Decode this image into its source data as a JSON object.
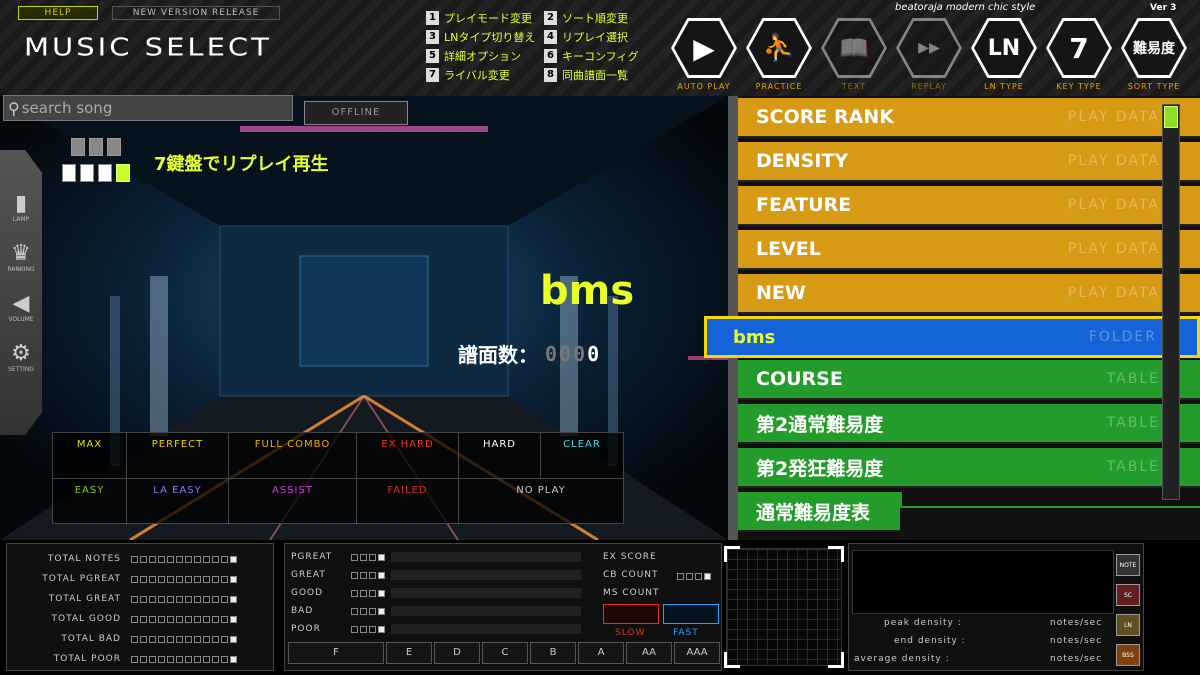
{
  "header": {
    "help_label": "HELP",
    "new_version_label": "NEW VERSION RELEASE",
    "title": "MUSIC SELECT",
    "skin_name": "beatoraja modern chic style",
    "version": "Ver 3"
  },
  "key_menu": [
    {
      "key": "1",
      "label": "プレイモード変更"
    },
    {
      "key": "2",
      "label": "ソート順変更"
    },
    {
      "key": "3",
      "label": "LNタイプ切り替え"
    },
    {
      "key": "4",
      "label": "リプレイ選択"
    },
    {
      "key": "5",
      "label": "詳細オプション"
    },
    {
      "key": "6",
      "label": "キーコンフィグ"
    },
    {
      "key": "7",
      "label": "ライバル変更"
    },
    {
      "key": "8",
      "label": "同曲譜面一覧"
    }
  ],
  "hex_buttons": [
    {
      "icon": "play-icon",
      "glyph": "▶",
      "label": "AUTO PLAY"
    },
    {
      "icon": "practice-icon",
      "glyph": "⛹",
      "label": "PRACTICE"
    },
    {
      "icon": "text-icon",
      "glyph": "📖",
      "label": "TEXT"
    },
    {
      "icon": "replay-icon",
      "glyph": "▶▶",
      "label": "REPLAY"
    },
    {
      "icon": "ln-icon",
      "glyph": "LN",
      "label": "LN TYPE"
    },
    {
      "icon": "key-type-icon",
      "glyph": "7",
      "label": "KEY TYPE"
    },
    {
      "icon": "sort-icon",
      "glyph": "難易度",
      "label": "SORT TYPE"
    }
  ],
  "search": {
    "placeholder": "search song"
  },
  "offline_label": "OFFLINE",
  "sidebar": [
    {
      "icon": "lamp-icon",
      "label": "LAMP"
    },
    {
      "icon": "ranking-icon",
      "label": "RANKING"
    },
    {
      "icon": "volume-icon",
      "label": "VOLUME"
    },
    {
      "icon": "setting-icon",
      "label": "SETTING"
    }
  ],
  "mode_text": "7鍵盤でリプレイ再生",
  "selected_song": "bms",
  "chart_count": {
    "label": "譜面数：",
    "digits": [
      "0",
      "0",
      "0",
      "0"
    ]
  },
  "lamps": {
    "row1": [
      {
        "label": "MAX",
        "color": "#e8e000"
      },
      {
        "label": "PERFECT",
        "color": "#f0d000"
      },
      {
        "label": "FULL COMBO",
        "color": "#f0b000"
      },
      {
        "label": "EX HARD",
        "color": "#ff3030"
      },
      {
        "label": "HARD",
        "color": "#ffffff"
      },
      {
        "label": "CLEAR",
        "color": "#40e0e8"
      }
    ],
    "row2": [
      {
        "label": "EASY",
        "color": "#80d020"
      },
      {
        "label": "LA EASY",
        "color": "#8080ff"
      },
      {
        "label": "ASSIST",
        "color": "#d040e0"
      },
      {
        "label": "FAILED",
        "color": "#e03020"
      },
      {
        "label": "NO PLAY",
        "color": "#cccccc"
      }
    ]
  },
  "list_items": [
    {
      "label": "SCORE RANK",
      "tag": "PLAY DATA",
      "type": "orange"
    },
    {
      "label": "DENSITY",
      "tag": "PLAY DATA",
      "type": "orange"
    },
    {
      "label": "FEATURE",
      "tag": "PLAY DATA",
      "type": "orange"
    },
    {
      "label": "LEVEL",
      "tag": "PLAY DATA",
      "type": "orange"
    },
    {
      "label": "NEW",
      "tag": "PLAY DATA",
      "type": "orange"
    },
    {
      "label": "bms",
      "tag": "FOLDER",
      "type": "sel"
    },
    {
      "label": "COURSE",
      "tag": "TABLE",
      "type": "green"
    },
    {
      "label": "第2通常難易度",
      "tag": "TABLE",
      "type": "green"
    },
    {
      "label": "第2発狂難易度",
      "tag": "TABLE",
      "type": "green"
    },
    {
      "label": "通常難易度表",
      "tag": "",
      "type": "green"
    }
  ],
  "stats": [
    "TOTAL NOTES",
    "TOTAL PGREAT",
    "TOTAL GREAT",
    "TOTAL GOOD",
    "TOTAL BAD",
    "TOTAL POOR"
  ],
  "judges": [
    "PGREAT",
    "GREAT",
    "GOOD",
    "BAD",
    "POOR"
  ],
  "score": {
    "ex_score": "EX SCORE",
    "cb_count": "CB COUNT",
    "ms_count": "MS COUNT",
    "slow": "SLOW",
    "fast": "FAST"
  },
  "grades": [
    "F",
    "E",
    "D",
    "C",
    "B",
    "A",
    "AA",
    "AAA"
  ],
  "density": {
    "peak": "peak density :",
    "end": "end density :",
    "average": "average density :",
    "unit": "notes/sec",
    "badges": [
      "NOTE",
      "SC",
      "LN",
      "BSS"
    ]
  },
  "colors": {
    "accent": "#e4ff3a",
    "orange": "#d69a14",
    "green": "#239c2b",
    "selected": "#1563d8"
  }
}
